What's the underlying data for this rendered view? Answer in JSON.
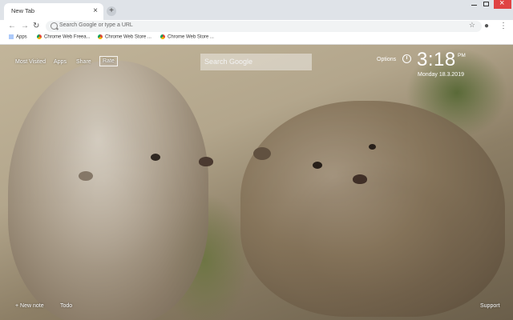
{
  "browser": {
    "tab": {
      "title": "New Tab",
      "close": "×"
    },
    "new_tab": "+",
    "toolbar": {
      "back": "←",
      "forward": "→",
      "reload": "↻",
      "search_placeholder": "Search Google or type a URL",
      "star": "☆",
      "profile": "●",
      "menu": "⋮"
    },
    "bookmarks": [
      "Apps",
      "Chrome Web Freea...",
      "Chrome Web Store ...",
      "Chrome Web Store ..."
    ]
  },
  "newtab": {
    "nav": [
      "Most Visited",
      "Apps",
      "Share",
      "Rate"
    ],
    "search": {
      "placeholder": "Search Google"
    },
    "options": "Options",
    "clock": {
      "time": "3:18",
      "ampm": "PM",
      "date": "Monday  18.3.2019"
    },
    "bottom_left": [
      "+ New note",
      "Todo"
    ],
    "bottom_right": "Support"
  }
}
